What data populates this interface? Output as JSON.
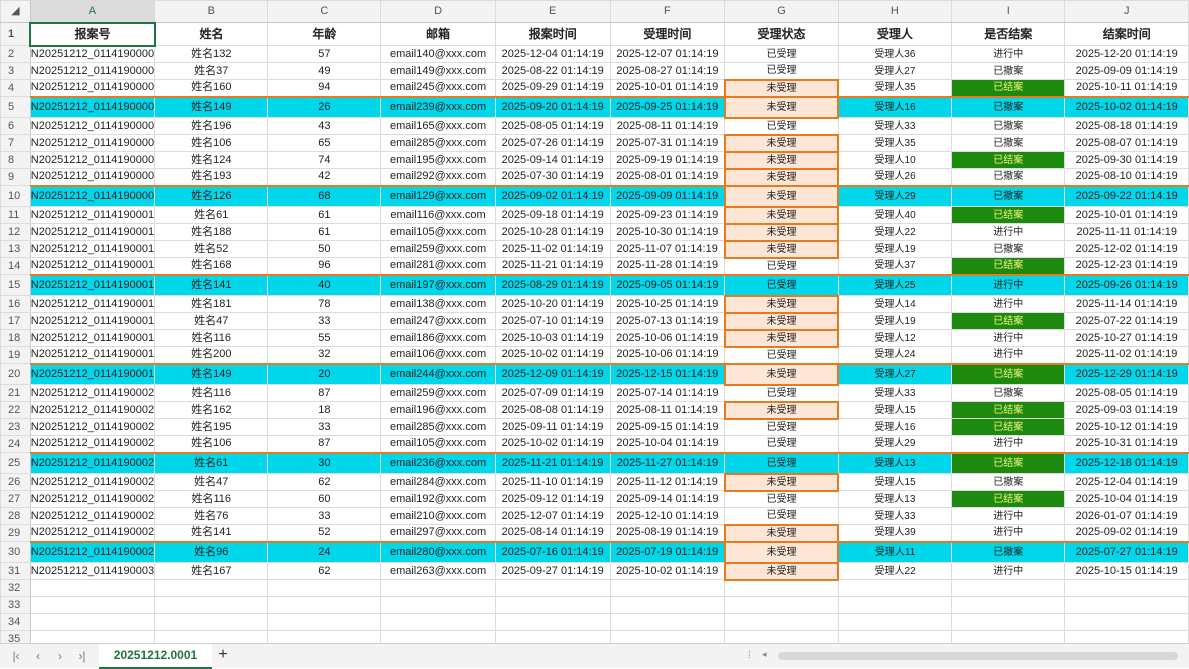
{
  "columns": [
    "A",
    "B",
    "C",
    "D",
    "E",
    "F",
    "G",
    "H",
    "I",
    "J"
  ],
  "headers": [
    "报案号",
    "姓名",
    "年龄",
    "邮箱",
    "报案时间",
    "受理时间",
    "受理状态",
    "受理人",
    "是否结案",
    "结案时间"
  ],
  "rows": [
    {
      "n": "2",
      "id": "N20251212_0114190000",
      "name": "姓名132",
      "age": "57",
      "email": "email140@xxx.com",
      "report": "2025-12-04 01:14:19",
      "accept": "2025-12-07 01:14:19",
      "status": "已受理",
      "handler": "受理人36",
      "closed": "进行中",
      "close_time": "2025-12-20 01:14:19"
    },
    {
      "n": "3",
      "id": "N20251212_0114190000",
      "name": "姓名37",
      "age": "49",
      "email": "email149@xxx.com",
      "report": "2025-08-22 01:14:19",
      "accept": "2025-08-27 01:14:19",
      "status": "已受理",
      "handler": "受理人27",
      "closed": "已撤案",
      "close_time": "2025-09-09 01:14:19"
    },
    {
      "n": "4",
      "id": "N20251212_0114190000",
      "name": "姓名160",
      "age": "94",
      "email": "email245@xxx.com",
      "report": "2025-09-29 01:14:19",
      "accept": "2025-10-01 01:14:19",
      "status": "未受理",
      "handler": "受理人35",
      "closed": "已结案",
      "close_time": "2025-10-11 01:14:19"
    },
    {
      "n": "5",
      "id": "N20251212_0114190000",
      "name": "姓名149",
      "age": "26",
      "email": "email239@xxx.com",
      "report": "2025-09-20 01:14:19",
      "accept": "2025-09-25 01:14:19",
      "status": "未受理",
      "handler": "受理人16",
      "closed": "已撤案",
      "close_time": "2025-10-02 01:14:19"
    },
    {
      "n": "6",
      "id": "N20251212_0114190000",
      "name": "姓名196",
      "age": "43",
      "email": "email165@xxx.com",
      "report": "2025-08-05 01:14:19",
      "accept": "2025-08-11 01:14:19",
      "status": "已受理",
      "handler": "受理人33",
      "closed": "已撤案",
      "close_time": "2025-08-18 01:14:19"
    },
    {
      "n": "7",
      "id": "N20251212_0114190000",
      "name": "姓名106",
      "age": "65",
      "email": "email285@xxx.com",
      "report": "2025-07-26 01:14:19",
      "accept": "2025-07-31 01:14:19",
      "status": "未受理",
      "handler": "受理人35",
      "closed": "已撤案",
      "close_time": "2025-08-07 01:14:19"
    },
    {
      "n": "8",
      "id": "N20251212_0114190000",
      "name": "姓名124",
      "age": "74",
      "email": "email195@xxx.com",
      "report": "2025-09-14 01:14:19",
      "accept": "2025-09-19 01:14:19",
      "status": "未受理",
      "handler": "受理人10",
      "closed": "已结案",
      "close_time": "2025-09-30 01:14:19"
    },
    {
      "n": "9",
      "id": "N20251212_0114190000",
      "name": "姓名193",
      "age": "42",
      "email": "email292@xxx.com",
      "report": "2025-07-30 01:14:19",
      "accept": "2025-08-01 01:14:19",
      "status": "未受理",
      "handler": "受理人26",
      "closed": "已撤案",
      "close_time": "2025-08-10 01:14:19"
    },
    {
      "n": "10",
      "id": "N20251212_0114190000",
      "name": "姓名126",
      "age": "68",
      "email": "email129@xxx.com",
      "report": "2025-09-02 01:14:19",
      "accept": "2025-09-09 01:14:19",
      "status": "未受理",
      "handler": "受理人29",
      "closed": "已撤案",
      "close_time": "2025-09-22 01:14:19"
    },
    {
      "n": "11",
      "id": "N20251212_0114190001",
      "name": "姓名61",
      "age": "61",
      "email": "email116@xxx.com",
      "report": "2025-09-18 01:14:19",
      "accept": "2025-09-23 01:14:19",
      "status": "未受理",
      "handler": "受理人40",
      "closed": "已结案",
      "close_time": "2025-10-01 01:14:19"
    },
    {
      "n": "12",
      "id": "N20251212_0114190001",
      "name": "姓名188",
      "age": "61",
      "email": "email105@xxx.com",
      "report": "2025-10-28 01:14:19",
      "accept": "2025-10-30 01:14:19",
      "status": "未受理",
      "handler": "受理人22",
      "closed": "进行中",
      "close_time": "2025-11-11 01:14:19"
    },
    {
      "n": "13",
      "id": "N20251212_0114190001",
      "name": "姓名52",
      "age": "50",
      "email": "email259@xxx.com",
      "report": "2025-11-02 01:14:19",
      "accept": "2025-11-07 01:14:19",
      "status": "未受理",
      "handler": "受理人19",
      "closed": "已撤案",
      "close_time": "2025-12-02 01:14:19"
    },
    {
      "n": "14",
      "id": "N20251212_0114190001",
      "name": "姓名168",
      "age": "96",
      "email": "email281@xxx.com",
      "report": "2025-11-21 01:14:19",
      "accept": "2025-11-28 01:14:19",
      "status": "已受理",
      "handler": "受理人37",
      "closed": "已结案",
      "close_time": "2025-12-23 01:14:19"
    },
    {
      "n": "15",
      "id": "N20251212_0114190001",
      "name": "姓名141",
      "age": "40",
      "email": "email197@xxx.com",
      "report": "2025-08-29 01:14:19",
      "accept": "2025-09-05 01:14:19",
      "status": "已受理",
      "handler": "受理人25",
      "closed": "进行中",
      "close_time": "2025-09-26 01:14:19"
    },
    {
      "n": "16",
      "id": "N20251212_0114190001",
      "name": "姓名181",
      "age": "78",
      "email": "email138@xxx.com",
      "report": "2025-10-20 01:14:19",
      "accept": "2025-10-25 01:14:19",
      "status": "未受理",
      "handler": "受理人14",
      "closed": "进行中",
      "close_time": "2025-11-14 01:14:19"
    },
    {
      "n": "17",
      "id": "N20251212_0114190001",
      "name": "姓名47",
      "age": "33",
      "email": "email247@xxx.com",
      "report": "2025-07-10 01:14:19",
      "accept": "2025-07-13 01:14:19",
      "status": "未受理",
      "handler": "受理人19",
      "closed": "已结案",
      "close_time": "2025-07-22 01:14:19"
    },
    {
      "n": "18",
      "id": "N20251212_0114190001",
      "name": "姓名116",
      "age": "55",
      "email": "email186@xxx.com",
      "report": "2025-10-03 01:14:19",
      "accept": "2025-10-06 01:14:19",
      "status": "未受理",
      "handler": "受理人12",
      "closed": "进行中",
      "close_time": "2025-10-27 01:14:19"
    },
    {
      "n": "19",
      "id": "N20251212_0114190001",
      "name": "姓名200",
      "age": "32",
      "email": "email106@xxx.com",
      "report": "2025-10-02 01:14:19",
      "accept": "2025-10-06 01:14:19",
      "status": "已受理",
      "handler": "受理人24",
      "closed": "进行中",
      "close_time": "2025-11-02 01:14:19"
    },
    {
      "n": "20",
      "id": "N20251212_0114190001",
      "name": "姓名149",
      "age": "20",
      "email": "email244@xxx.com",
      "report": "2025-12-09 01:14:19",
      "accept": "2025-12-15 01:14:19",
      "status": "未受理",
      "handler": "受理人27",
      "closed": "已结案",
      "close_time": "2025-12-29 01:14:19"
    },
    {
      "n": "21",
      "id": "N20251212_0114190002",
      "name": "姓名116",
      "age": "87",
      "email": "email259@xxx.com",
      "report": "2025-07-09 01:14:19",
      "accept": "2025-07-14 01:14:19",
      "status": "已受理",
      "handler": "受理人33",
      "closed": "已撤案",
      "close_time": "2025-08-05 01:14:19"
    },
    {
      "n": "22",
      "id": "N20251212_0114190002",
      "name": "姓名162",
      "age": "18",
      "email": "email196@xxx.com",
      "report": "2025-08-08 01:14:19",
      "accept": "2025-08-11 01:14:19",
      "status": "未受理",
      "handler": "受理人15",
      "closed": "已结案",
      "close_time": "2025-09-03 01:14:19"
    },
    {
      "n": "23",
      "id": "N20251212_0114190002",
      "name": "姓名195",
      "age": "33",
      "email": "email285@xxx.com",
      "report": "2025-09-11 01:14:19",
      "accept": "2025-09-15 01:14:19",
      "status": "已受理",
      "handler": "受理人16",
      "closed": "已结案",
      "close_time": "2025-10-12 01:14:19"
    },
    {
      "n": "24",
      "id": "N20251212_0114190002",
      "name": "姓名106",
      "age": "87",
      "email": "email105@xxx.com",
      "report": "2025-10-02 01:14:19",
      "accept": "2025-10-04 01:14:19",
      "status": "已受理",
      "handler": "受理人29",
      "closed": "进行中",
      "close_time": "2025-10-31 01:14:19"
    },
    {
      "n": "25",
      "id": "N20251212_0114190002",
      "name": "姓名61",
      "age": "30",
      "email": "email236@xxx.com",
      "report": "2025-11-21 01:14:19",
      "accept": "2025-11-27 01:14:19",
      "status": "已受理",
      "handler": "受理人13",
      "closed": "已结案",
      "close_time": "2025-12-18 01:14:19"
    },
    {
      "n": "26",
      "id": "N20251212_0114190002",
      "name": "姓名47",
      "age": "62",
      "email": "email284@xxx.com",
      "report": "2025-11-10 01:14:19",
      "accept": "2025-11-12 01:14:19",
      "status": "未受理",
      "handler": "受理人15",
      "closed": "已撤案",
      "close_time": "2025-12-04 01:14:19"
    },
    {
      "n": "27",
      "id": "N20251212_0114190002",
      "name": "姓名116",
      "age": "60",
      "email": "email192@xxx.com",
      "report": "2025-09-12 01:14:19",
      "accept": "2025-09-14 01:14:19",
      "status": "已受理",
      "handler": "受理人13",
      "closed": "已结案",
      "close_time": "2025-10-04 01:14:19"
    },
    {
      "n": "28",
      "id": "N20251212_0114190002",
      "name": "姓名76",
      "age": "33",
      "email": "email210@xxx.com",
      "report": "2025-12-07 01:14:19",
      "accept": "2025-12-10 01:14:19",
      "status": "已受理",
      "handler": "受理人33",
      "closed": "进行中",
      "close_time": "2026-01-07 01:14:19"
    },
    {
      "n": "29",
      "id": "N20251212_0114190002",
      "name": "姓名141",
      "age": "52",
      "email": "email297@xxx.com",
      "report": "2025-08-14 01:14:19",
      "accept": "2025-08-19 01:14:19",
      "status": "未受理",
      "handler": "受理人39",
      "closed": "进行中",
      "close_time": "2025-09-02 01:14:19"
    },
    {
      "n": "30",
      "id": "N20251212_0114190002",
      "name": "姓名96",
      "age": "24",
      "email": "email280@xxx.com",
      "report": "2025-07-16 01:14:19",
      "accept": "2025-07-19 01:14:19",
      "status": "未受理",
      "handler": "受理人11",
      "closed": "已撤案",
      "close_time": "2025-07-27 01:14:19"
    },
    {
      "n": "31",
      "id": "N20251212_0114190003",
      "name": "姓名167",
      "age": "62",
      "email": "email263@xxx.com",
      "report": "2025-09-27 01:14:19",
      "accept": "2025-10-02 01:14:19",
      "status": "未受理",
      "handler": "受理人22",
      "closed": "进行中",
      "close_time": "2025-10-15 01:14:19"
    }
  ],
  "empty_rows": [
    "32",
    "33",
    "34",
    "35"
  ],
  "tabs": {
    "sheet": "20251212.0001",
    "add": "+"
  },
  "colors": {
    "cyan": "#00d7ea",
    "pending_fill": "#fde6d6",
    "pending_border": "#e77a1c",
    "closed_fill": "#1d8a0f",
    "closed_text": "#f4f47a",
    "accent": "#217346"
  }
}
